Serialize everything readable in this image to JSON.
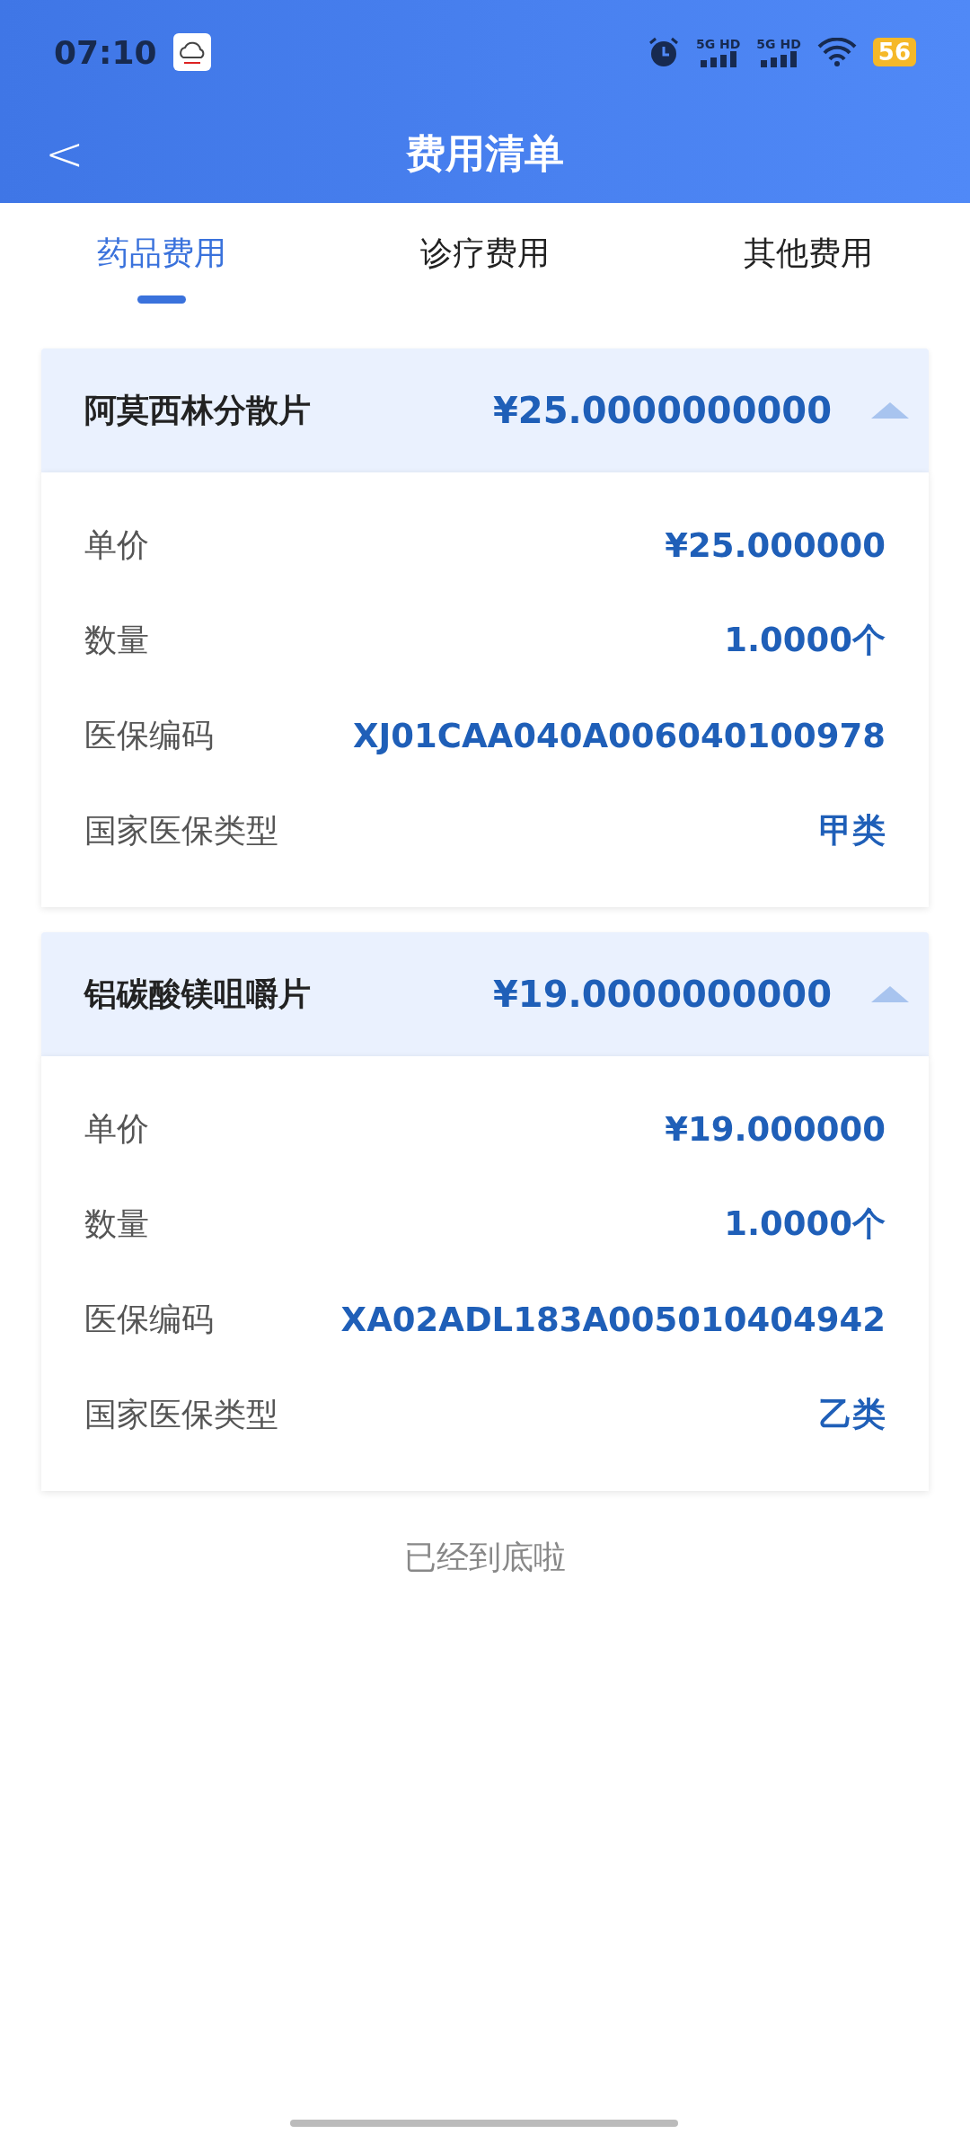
{
  "status_bar": {
    "time": "07:10",
    "network_labels": [
      "5G HD",
      "5G HD"
    ],
    "battery": "56"
  },
  "nav": {
    "back": "<",
    "title": "费用清单"
  },
  "tabs": [
    {
      "label": "药品费用",
      "selected": true
    },
    {
      "label": "诊疗费用",
      "selected": false
    },
    {
      "label": "其他费用",
      "selected": false
    }
  ],
  "items": [
    {
      "name": "阿莫西林分散片",
      "total": "¥25.0000000000",
      "expanded": true,
      "details": [
        {
          "label": "单价",
          "value": "¥25.000000"
        },
        {
          "label": "数量",
          "value": "1.0000个"
        },
        {
          "label": "医保编码",
          "value": "XJ01CAA040A006040100978"
        },
        {
          "label": "国家医保类型",
          "value": "甲类"
        }
      ]
    },
    {
      "name": "铝碳酸镁咀嚼片",
      "total": "¥19.0000000000",
      "expanded": true,
      "details": [
        {
          "label": "单价",
          "value": "¥19.000000"
        },
        {
          "label": "数量",
          "value": "1.0000个"
        },
        {
          "label": "医保编码",
          "value": "XA02ADL183A005010404942"
        },
        {
          "label": "国家医保类型",
          "value": "乙类"
        }
      ]
    }
  ],
  "footer": "已经到底啦"
}
